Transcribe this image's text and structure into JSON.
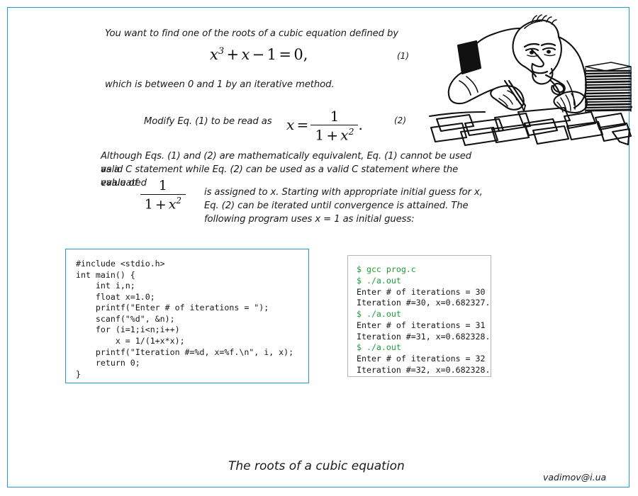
{
  "page": {
    "border_color": "#1f9ad6",
    "background": "#ffffff"
  },
  "body": {
    "intro_line": "You want to find one of the roots of a cubic equation defined by",
    "between_line": "which is between 0 and 1 by an iterative method.",
    "modify_lead": "Modify Eq. (1) to be read as",
    "paragraph_line1": "Although Eqs. (1) and (2) are mathematically equivalent, Eq. (1) cannot be used as a",
    "paragraph_line2": "valid C statement while Eq. (2) can be used as a valid C statement where the evaluated",
    "paragraph_line3": "value of",
    "paragraph_line4": "is assigned to x. Starting with appropriate initial guess for x,",
    "paragraph_line5": "Eq. (2) can be iterated until convergence is attained. The",
    "paragraph_line6": "following program uses x  =  1 as initial guess:"
  },
  "equations": {
    "eq1": {
      "number": "(1)",
      "lhs_var": "x",
      "lhs_exp": "3",
      "plus": "+",
      "term2": "x",
      "minus": "−",
      "one": "1",
      "equals": "=",
      "rhs": "0,"
    },
    "eq2": {
      "number": "(2)",
      "var": "x",
      "equals": "=",
      "numerator": "1",
      "den_one": "1",
      "den_plus": "+",
      "den_var": "x",
      "den_exp": "2",
      "period": "."
    },
    "inline_frac": {
      "numerator": "1",
      "den_one": "1",
      "den_plus": "+",
      "den_var": "x",
      "den_exp": "2"
    }
  },
  "code_panel": {
    "border_color": "#1f9ad6",
    "language": "C",
    "source": "#include <stdio.h>\nint main() {\n    int i,n;\n    float x=1.0;\n    printf(\"Enter # of iterations = \");\n    scanf(\"%d\", &n);\n    for (i=1;i<n;i++)\n        x = 1/(1+x*x);\n    printf(\"Iteration #=%d, x=%f.\\n\", i, x);\n    return 0;\n}"
  },
  "terminal_panel": {
    "border_color": "#b4b4b4",
    "prompt_color": "#1f9d3a",
    "lines": [
      {
        "type": "command",
        "text": "$ gcc prog.c"
      },
      {
        "type": "command",
        "text": "$ ./a.out"
      },
      {
        "type": "output",
        "text": "Enter # of iterations = 30"
      },
      {
        "type": "output",
        "text": "Iteration #=30, x=0.682327."
      },
      {
        "type": "command",
        "text": "$ ./a.out"
      },
      {
        "type": "output",
        "text": "Enter # of iterations = 31"
      },
      {
        "type": "output",
        "text": "Iteration #=31, x=0.682328."
      },
      {
        "type": "command",
        "text": "$ ./a.out"
      },
      {
        "type": "output",
        "text": "Enter # of iterations = 32"
      },
      {
        "type": "output",
        "text": "Iteration #=32, x=0.682328."
      }
    ]
  },
  "footer": {
    "caption": "The roots of a cubic equation",
    "email": "vadimov@i.ua"
  },
  "illustration": {
    "name": "man-writing-at-desk-cartoon",
    "description": "Line-art cartoon of a frowning man smoking a pipe, writing on papers at a desk with a tall stack of papers beside him"
  }
}
